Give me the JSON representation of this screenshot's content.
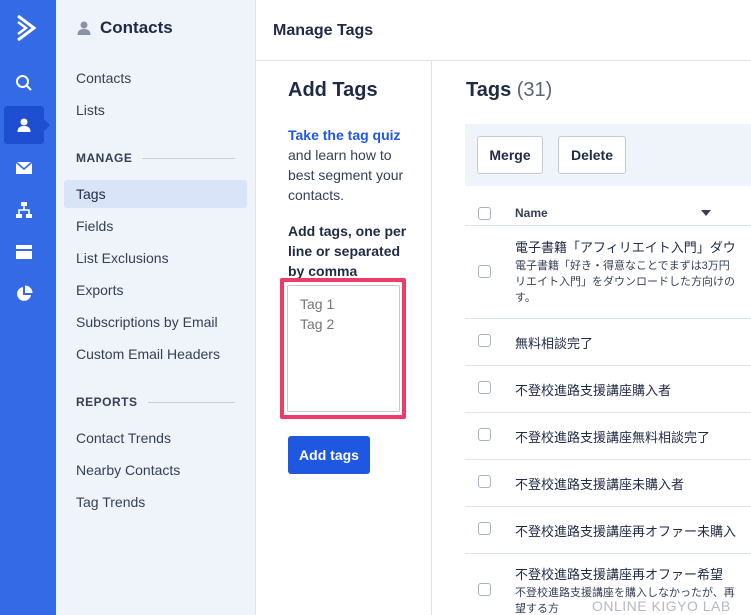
{
  "header": {
    "title": "Manage Tags"
  },
  "sidebar": {
    "section_title": "Contacts",
    "top_items": [
      {
        "label": "Contacts"
      },
      {
        "label": "Lists"
      }
    ],
    "manage_heading": "MANAGE",
    "manage_items": [
      {
        "label": "Tags",
        "active": true
      },
      {
        "label": "Fields"
      },
      {
        "label": "List Exclusions"
      },
      {
        "label": "Exports"
      },
      {
        "label": "Subscriptions by Email"
      },
      {
        "label": "Custom Email Headers"
      }
    ],
    "reports_heading": "REPORTS",
    "reports_items": [
      {
        "label": "Contact Trends"
      },
      {
        "label": "Nearby Contacts"
      },
      {
        "label": "Tag Trends"
      }
    ]
  },
  "rail": {
    "icons": [
      "logo-icon",
      "search-icon",
      "contacts-icon",
      "email-icon",
      "automations-icon",
      "site-icon",
      "reports-icon"
    ],
    "active": "contacts-icon"
  },
  "add_tags": {
    "title": "Add Tags",
    "quiz_link": "Take the tag quiz",
    "quiz_text": "and learn how to best segment your contacts.",
    "input_label": "Add tags, one per line or separated by comma",
    "placeholder": "Tag 1\nTag 2",
    "button_label": "Add tags"
  },
  "tags": {
    "title": "Tags",
    "count": "(31)",
    "merge_label": "Merge",
    "delete_label": "Delete",
    "column_name": "Name",
    "rows": [
      {
        "name": "電子書籍「アフィリエイト入門」ダウ",
        "desc": [
          "電子書籍「好き・得意なことでまずは3万円",
          "リエイト入門」をダウンロードした方向けの",
          "す。"
        ]
      },
      {
        "name": "無料相談完了"
      },
      {
        "name": "不登校進路支援講座購入者"
      },
      {
        "name": "不登校進路支援講座無料相談完了"
      },
      {
        "name": "不登校進路支援講座未購入者"
      },
      {
        "name": "不登校進路支援講座再オファー未購入"
      },
      {
        "name": "不登校進路支援講座再オファー希望",
        "desc": [
          "不登校進路支援講座を購入しなかったが、再",
          "望する方"
        ]
      }
    ]
  },
  "watermark": "ONLINE KIGYO LAB",
  "colors": {
    "rail": "#356ae6",
    "accent": "#1e57e0",
    "highlight": "#ee3c6a",
    "sidebar_bg": "#eff3fa"
  }
}
